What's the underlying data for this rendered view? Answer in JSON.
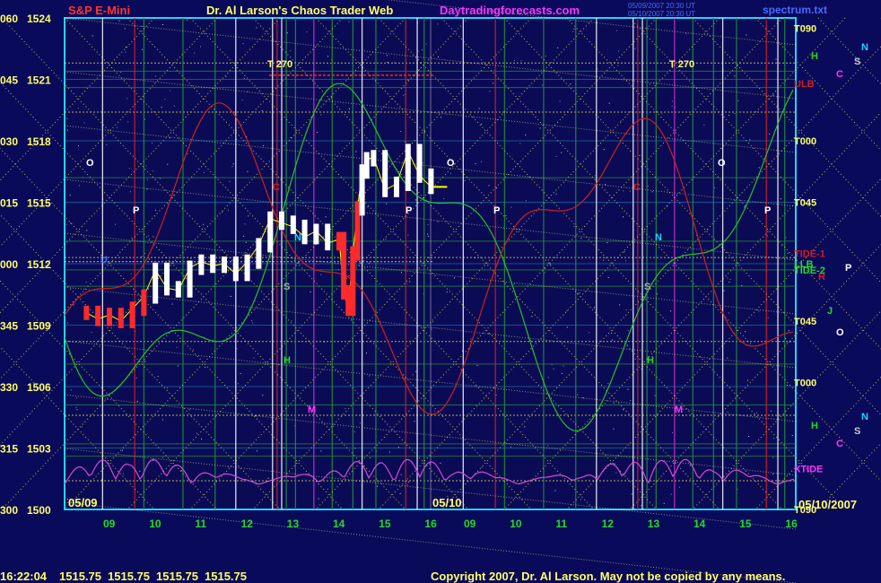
{
  "header": {
    "symbol": "S&P E-Mini",
    "site_title": "Dr. Al Larson's Chaos Trader Web",
    "site_url": "Daytradingforecasts.com",
    "datestamp_line1": "05/09/2007 20:30 UT",
    "datestamp_line2": "05/10/2007 20:30 UT",
    "spectrum_file": "spectrum.txt"
  },
  "footer": {
    "timestamp": "16:22:04",
    "quote_values": [
      "1515.75",
      "1515.75",
      "1515.75",
      "1515.75"
    ],
    "copyright": "Copyright 2007, Dr. Al Larson. May not be copied by any means."
  },
  "date_labels": [
    "05/09",
    "05/10",
    "05/10/2007"
  ],
  "line_labels": {
    "t270": "T 270",
    "right_markers": [
      "T090",
      "ULB",
      "T000",
      "T045",
      "TIDE-1",
      "LLB",
      "TIDE-2",
      "T045",
      "T000",
      "XTIDE",
      "T090"
    ],
    "plot_letters": [
      "O",
      "P",
      "N",
      "S",
      "H",
      "M",
      "C",
      "U",
      "J",
      "R"
    ]
  },
  "colors": {
    "background": "#0a0a5a",
    "plot_bg": "#0b0b55",
    "price": "#ffffff",
    "price_red": "#ff2a2a",
    "ma_yellow": "#ffff00",
    "flux_green": "#26c226",
    "flux_red": "#d21e1e",
    "spectrum": "#d24ad2",
    "grid_green": "#1f8f3a",
    "grid_yellow": "#e6e65a",
    "axis_cyan": "#22d3ff",
    "text_green": "#22dd22",
    "text_yellow": "#ffff66",
    "title_red": "#ff3333",
    "url_magenta": "#ff33ff"
  },
  "chart_data": {
    "type": "line",
    "title": "S&P E-Mini",
    "ylim": [
      1500,
      1524
    ],
    "y_ticks": [
      {
        "code": "300",
        "price": 1500
      },
      {
        "code": "315",
        "price": 1503
      },
      {
        "code": "330",
        "price": 1506
      },
      {
        "code": "345",
        "price": 1509
      },
      {
        "code": "000",
        "price": 1512
      },
      {
        "code": "015",
        "price": 1515
      },
      {
        "code": "030",
        "price": 1518
      },
      {
        "code": "045",
        "price": 1521
      },
      {
        "code": "060",
        "price": 1524
      }
    ],
    "x_ticks_day1": [
      "09",
      "10",
      "11",
      "12",
      "13",
      "14",
      "15",
      "16"
    ],
    "x_ticks_day2": [
      "09",
      "10",
      "11",
      "12",
      "13",
      "14",
      "15",
      "16"
    ],
    "price_series": {
      "name": "S&P E-Mini 5-min",
      "hours": [
        8.5,
        8.75,
        9.0,
        9.25,
        9.5,
        9.75,
        10.0,
        10.25,
        10.5,
        10.75,
        11.0,
        11.25,
        11.5,
        11.75,
        12.0,
        12.25,
        12.5,
        12.75,
        13.0,
        13.25,
        13.5,
        13.75,
        14.0,
        14.1,
        14.2,
        14.3,
        14.4,
        14.5,
        14.6,
        14.75,
        15.0,
        15.25,
        15.5,
        15.75,
        16.0
      ],
      "close": [
        1509.6,
        1509.3,
        1509.5,
        1509.2,
        1509.8,
        1510.4,
        1511.7,
        1510.8,
        1510.7,
        1511.8,
        1512.1,
        1511.9,
        1512.0,
        1511.5,
        1512.1,
        1512.9,
        1514.2,
        1514.0,
        1513.8,
        1513.3,
        1513.6,
        1513.0,
        1513.2,
        1510.6,
        1509.8,
        1512.5,
        1514.7,
        1516.5,
        1517.1,
        1517.2,
        1515.6,
        1515.9,
        1517.5,
        1516.3,
        1515.75
      ]
    },
    "last_price": 1515.75
  }
}
